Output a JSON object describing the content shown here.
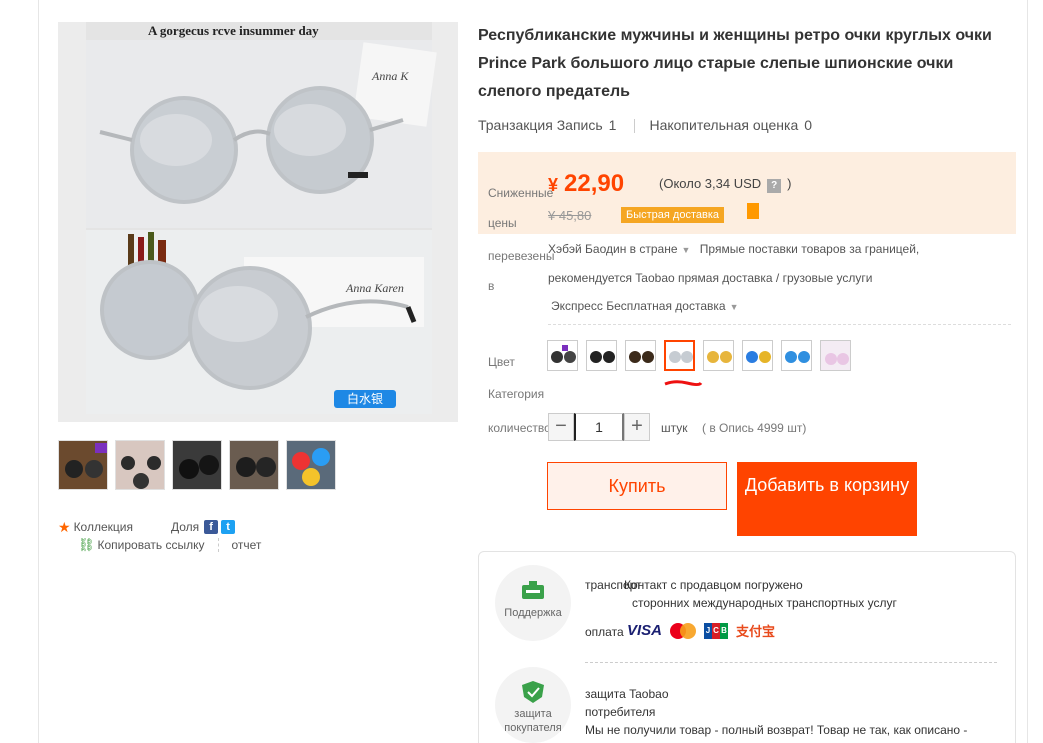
{
  "product": {
    "title": "Республиканские мужчины и женщины ретро очки круглых очки Prince Park большого лицо старые слепые шпионские очки слепого предатель",
    "image_caption_top": "A gorgecus rcve insummer day",
    "image_brand_text_1": "Anna K",
    "image_brand_text_2": "Anna Karen",
    "image_badge": "白水银"
  },
  "stats": {
    "transactions_label": "Транзакция Запись",
    "transactions_value": "1",
    "rating_label": "Накопительная оценка",
    "rating_value": "0"
  },
  "price": {
    "label": "Сниженные цены",
    "currency": "¥",
    "amount": "22,90",
    "approx": "(Около 3,34 USD",
    "approx_close": ")",
    "help": "?",
    "old_price": "¥ 45,80",
    "fast_delivery": "Быстрая доставка"
  },
  "shipping": {
    "label": "перевезены в",
    "from": "Хэбэй Баодин в",
    "region": "стране",
    "direct": "Прямые поставки товаров за границей,",
    "recommend": "рекомендуется Taobao прямая доставка / грузовые услуги",
    "express": "Экспресс Бесплатная доставка"
  },
  "color": {
    "label": "Цвет Категория",
    "swatch_count": 8,
    "selected_index": 3
  },
  "quantity": {
    "label": "количество",
    "minus": "−",
    "value": "1",
    "plus": "+",
    "unit": "штук",
    "stock": "( в Опись 4999 шт)"
  },
  "buttons": {
    "buy": "Купить",
    "cart": "Добавить в корзину"
  },
  "left_actions": {
    "favorite": "Коллекция",
    "share": "Доля",
    "facebook": "f",
    "twitter": "t",
    "copy_link": "Копировать ссылку",
    "report": "отчет"
  },
  "services": {
    "support_label": "Поддержка",
    "transport_label": "транспорт",
    "transport_text_1": "Контакт с продавцом погружено",
    "transport_text_2": "сторонних международных транспортных услуг",
    "payment_label": "оплата",
    "visa": "VISA",
    "jcb": [
      "J",
      "C",
      "B"
    ],
    "alipay": "支付宝",
    "protection_label": "защита покупателя",
    "taobao_protection": "защита Taobao",
    "consumer": "потребителя",
    "refund_text": "Мы не получили товар - полный возврат! Товар не так, как описано -"
  },
  "colors": {
    "accent": "#ff4400",
    "price_bg": "#fdeee0",
    "badge": "#f5a623"
  }
}
